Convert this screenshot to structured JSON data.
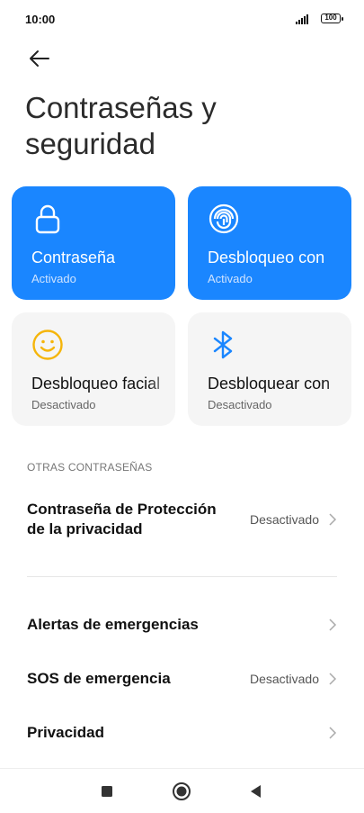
{
  "status_bar": {
    "time": "10:00",
    "battery": "100"
  },
  "header": {
    "title": "Contraseñas y seguridad"
  },
  "tiles": [
    {
      "title": "Contraseña",
      "subtitle": "Activado",
      "icon": "lock-icon"
    },
    {
      "title": "Desbloqueo con",
      "subtitle": "Activado",
      "icon": "fingerprint-icon"
    },
    {
      "title": "Desbloqueo facial",
      "subtitle": "Desactivado",
      "icon": "smiley-face-icon"
    },
    {
      "title": "Desbloquear con",
      "subtitle": "Desactivado",
      "icon": "bluetooth-icon"
    }
  ],
  "section_other": {
    "label": "OTRAS CONTRASEÑAS"
  },
  "rows": [
    {
      "label_line1": "Contraseña de Protección",
      "label_line2": "de la privacidad",
      "value": "Desactivado"
    },
    {
      "label": "Alertas de emergencias",
      "value": ""
    },
    {
      "label": "SOS de emergencia",
      "value": "Desactivado"
    },
    {
      "label": "Privacidad",
      "value": ""
    }
  ],
  "colors": {
    "accent": "#1a86ff",
    "tile_off": "#f5f5f5",
    "face_icon": "#f5b50a"
  }
}
